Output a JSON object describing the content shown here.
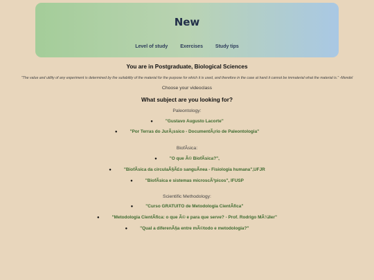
{
  "brand": "New",
  "nav": [
    "Level of study",
    "Exercises",
    "Study tips"
  ],
  "location": "You are in Postgraduate, Biological Sciences",
  "quote": "\"The value and utility of any experiment is determined by the suitability of the material for the purpose for which it is used, and therefore in the case at hand it cannot be immaterial what the material is.\" -Mendel",
  "choose_label": "Choose your videoclass",
  "question": "What subject are you looking for?",
  "categories": [
    {
      "name": "Paleontology:",
      "items": [
        "\"Gustavo Augusto Lacorte\"",
        "\"Por Terras do JurÃ¡ssico - DocumentÃ¡rio de Paleontologia\""
      ]
    },
    {
      "name": "BiofÃ­sica:",
      "items": [
        "\"O que Ã© BiofÃ­sica?\",",
        "\"BiofÃ­sica da circulaÃ§Ã£o sanguÃ­nea - Fisiologia humana\",UFJR",
        "\"BiofÃ­sica e sistemas microscÃ³picos\", IFUSP"
      ]
    },
    {
      "name": "Scientific Methodology:",
      "items": [
        "\"Curso GRATUITO de Metodologia CientÃ­fica\"",
        "\"Metodologia CientÃ­fica: o que Ã© e para que serve? - Prof. Rodrigo MÃ¼ller\"",
        "\"Qual a diferenÃ§a entre mÃ©todo e metodologia?\""
      ]
    }
  ]
}
